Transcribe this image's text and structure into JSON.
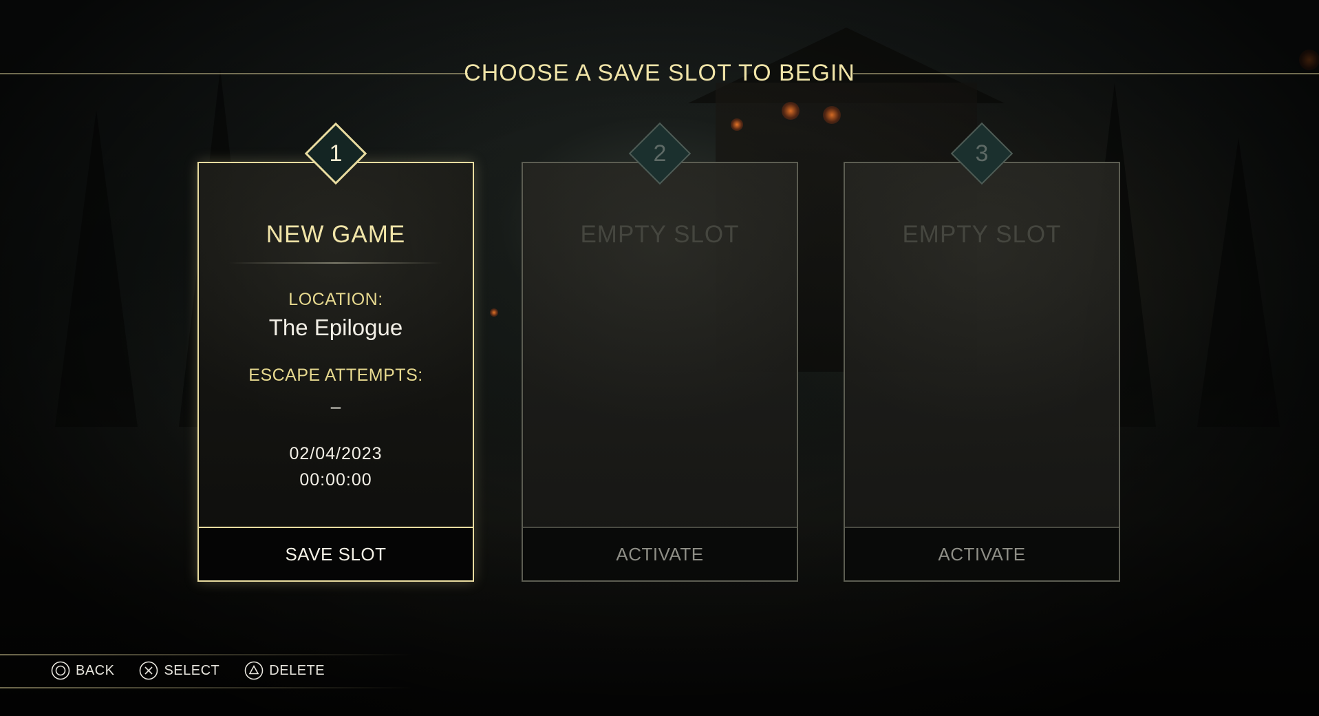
{
  "header": {
    "title": "CHOOSE A SAVE SLOT TO BEGIN"
  },
  "slots": [
    {
      "number": "1",
      "heading": "NEW GAME",
      "location_label": "LOCATION:",
      "location_value": "The Epilogue",
      "attempts_label": "ESCAPE ATTEMPTS:",
      "attempts_value": "–",
      "date": "02/04/2023",
      "time": "00:00:00",
      "action_label": "SAVE SLOT",
      "selected": true
    },
    {
      "number": "2",
      "heading": "EMPTY SLOT",
      "action_label": "ACTIVATE",
      "selected": false
    },
    {
      "number": "3",
      "heading": "EMPTY SLOT",
      "action_label": "ACTIVATE",
      "selected": false
    }
  ],
  "controls": [
    {
      "icon": "circle-button-icon",
      "label": "BACK"
    },
    {
      "icon": "cross-button-icon",
      "label": "SELECT"
    },
    {
      "icon": "triangle-button-icon",
      "label": "DELETE"
    }
  ],
  "colors": {
    "accent_gold": "#f0e4a8",
    "label_gold": "#e7d98f",
    "selected_border": "#e9dca0",
    "diamond_teal": "#1b302e",
    "inactive_text": "#45463f",
    "ember_orange": "#f07828"
  }
}
